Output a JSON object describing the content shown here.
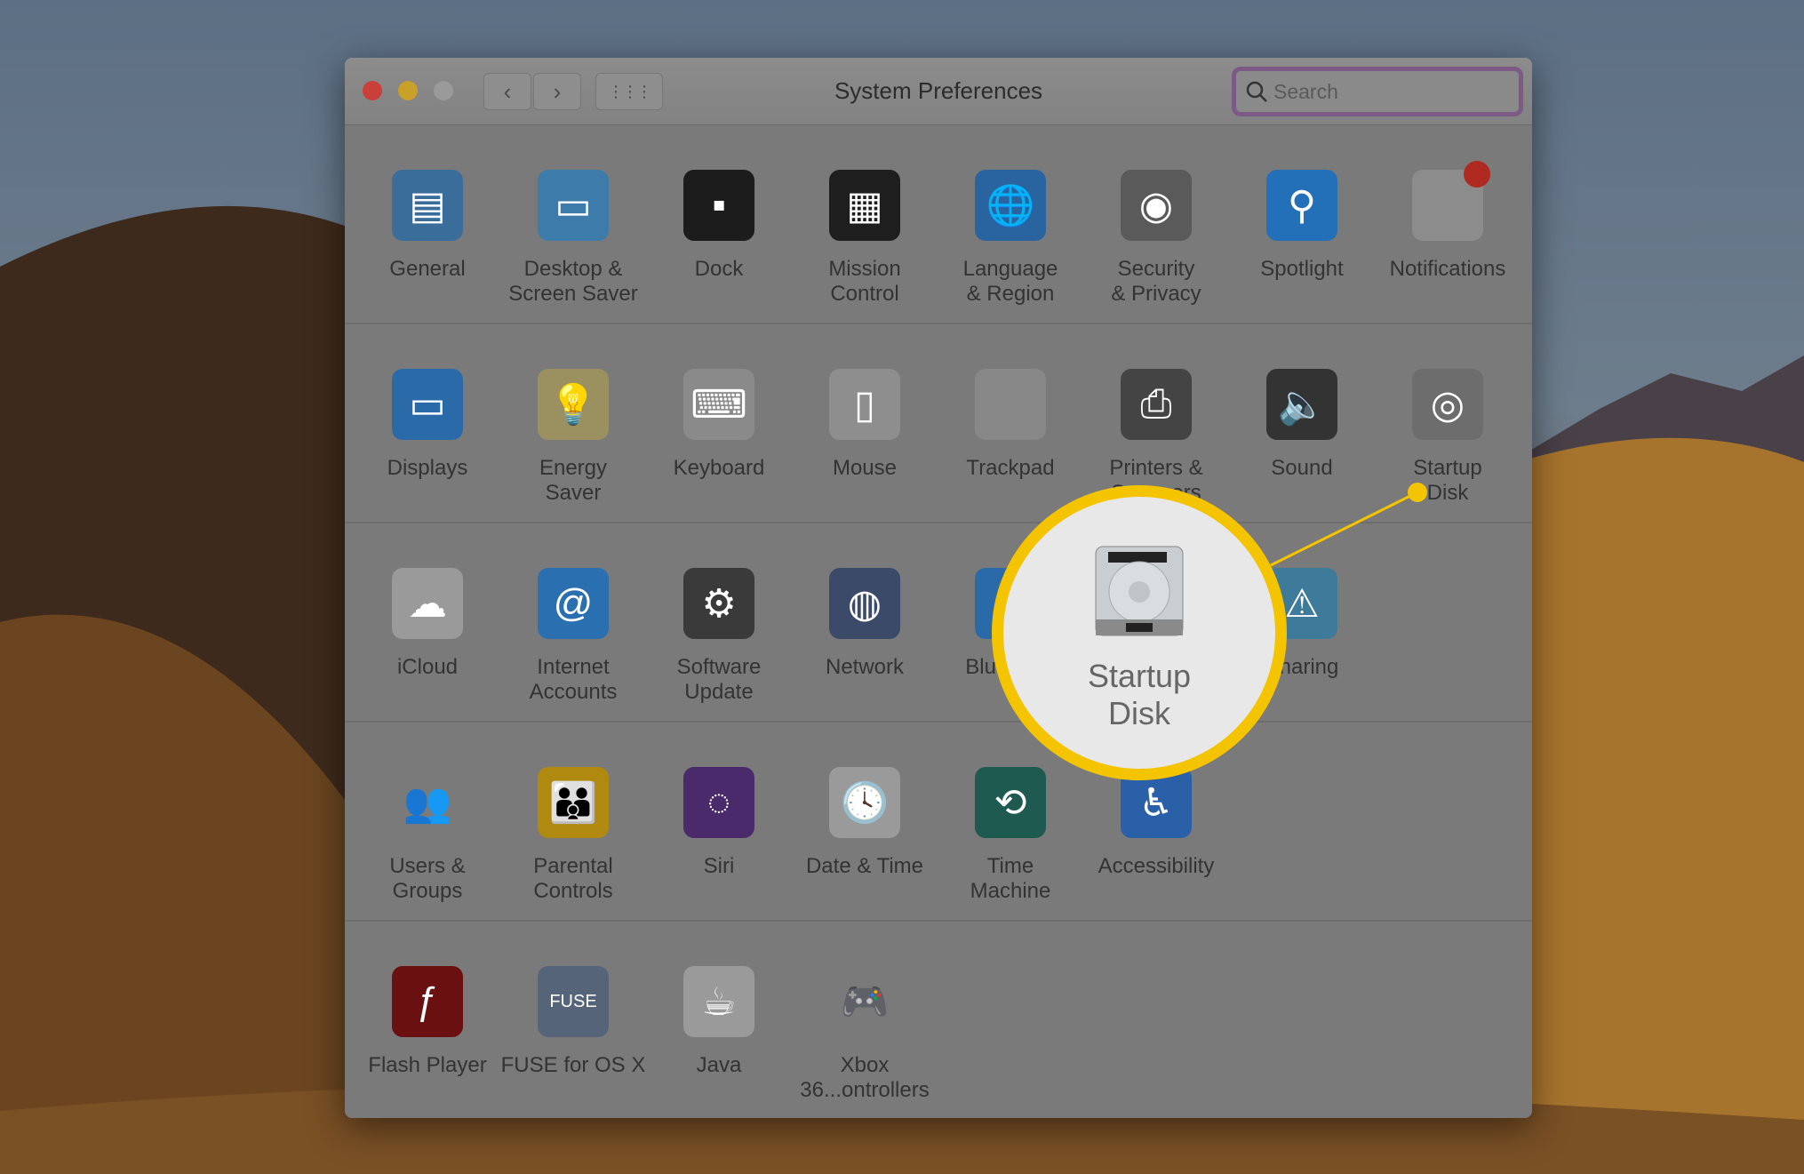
{
  "window": {
    "title": "System Preferences",
    "search_placeholder": "Search"
  },
  "titlebar": {
    "back": "‹",
    "forward": "›",
    "grid": "⋮⋮⋮"
  },
  "colors": {
    "close": "#c9403a",
    "minimize": "#c9a028",
    "zoom": "#9a9a9a",
    "highlight": "#f4c400",
    "search_focus": "#7d5a86"
  },
  "rows": [
    [
      {
        "label": "General",
        "icon": "general-icon",
        "color": "#3a6d9a",
        "glyph": "▤"
      },
      {
        "label": "Desktop &\nScreen Saver",
        "icon": "desktop-icon",
        "color": "#3d7bab",
        "glyph": "▭"
      },
      {
        "label": "Dock",
        "icon": "dock-icon",
        "color": "#1c1c1c",
        "glyph": "▪"
      },
      {
        "label": "Mission\nControl",
        "icon": "mission-control-icon",
        "color": "#1e1e1e",
        "glyph": "▦"
      },
      {
        "label": "Language\n& Region",
        "icon": "flag-globe-icon",
        "color": "#2a64a0",
        "glyph": "🌐"
      },
      {
        "label": "Security\n& Privacy",
        "icon": "security-house-icon",
        "color": "#5a5a5a",
        "glyph": "◉"
      },
      {
        "label": "Spotlight",
        "icon": "spotlight-magnifier-icon",
        "color": "#2370b8",
        "glyph": "⚲"
      },
      {
        "label": "Notifications",
        "icon": "notifications-icon",
        "color": "#8c8c8c",
        "glyph": ""
      }
    ],
    [
      {
        "label": "Displays",
        "icon": "display-icon",
        "color": "#2a6aa8",
        "glyph": "▭"
      },
      {
        "label": "Energy\nSaver",
        "icon": "lightbulb-icon",
        "color": "#9a9060",
        "glyph": "💡"
      },
      {
        "label": "Keyboard",
        "icon": "keyboard-icon",
        "color": "#8a8a8a",
        "glyph": "⌨"
      },
      {
        "label": "Mouse",
        "icon": "mouse-icon",
        "color": "#8e8e8e",
        "glyph": "▯"
      },
      {
        "label": "Trackpad",
        "icon": "trackpad-icon",
        "color": "#888",
        "glyph": ""
      },
      {
        "label": "Printers &\nScanners",
        "icon": "printer-icon",
        "color": "#444",
        "glyph": "⎙"
      },
      {
        "label": "Sound",
        "icon": "speaker-icon",
        "color": "#333",
        "glyph": "🔈"
      },
      {
        "label": "Startup\nDisk",
        "icon": "hard-disk-icon",
        "color": "#6d6d6d",
        "glyph": "◎"
      }
    ],
    [
      {
        "label": "iCloud",
        "icon": "icloud-icon",
        "color": "#9a9a9a",
        "glyph": "☁"
      },
      {
        "label": "Internet\nAccounts",
        "icon": "at-sign-icon",
        "color": "#2a70b0",
        "glyph": "@"
      },
      {
        "label": "Software\nUpdate",
        "icon": "gear-icon",
        "color": "#3a3a3a",
        "glyph": "⚙"
      },
      {
        "label": "Network",
        "icon": "globe-icon",
        "color": "#3c4a6a",
        "glyph": "◍"
      },
      {
        "label": "Bluetooth",
        "icon": "bluetooth-icon",
        "color": "#2a6aa8",
        "glyph": "ᛒ"
      },
      null,
      {
        "label": "Sharing",
        "icon": "sharing-folder-icon",
        "color": "#3e7a9a",
        "glyph": "⚠"
      }
    ],
    [
      {
        "label": "Users &\nGroups",
        "icon": "users-icon",
        "color": "transparent",
        "glyph": "👥"
      },
      {
        "label": "Parental\nControls",
        "icon": "parental-controls-icon",
        "color": "#b08a10",
        "glyph": "👪"
      },
      {
        "label": "Siri",
        "icon": "siri-icon",
        "color": "#4a2a6a",
        "glyph": "◌"
      },
      {
        "label": "Date & Time",
        "icon": "clock-calendar-icon",
        "color": "#9a9a9a",
        "glyph": "🕓"
      },
      {
        "label": "Time\nMachine",
        "icon": "time-machine-icon",
        "color": "#1e5a50",
        "glyph": "⟲"
      },
      {
        "label": "Accessibility",
        "icon": "accessibility-icon",
        "color": "#2a60a8",
        "glyph": "♿"
      }
    ],
    [
      {
        "label": "Flash Player",
        "icon": "flash-icon",
        "color": "#6a1010",
        "glyph": "ƒ"
      },
      {
        "label": "FUSE for OS X",
        "icon": "fuse-disk-icon",
        "color": "#56647a",
        "glyph": "FUSE"
      },
      {
        "label": "Java",
        "icon": "java-icon",
        "color": "#9a9a9a",
        "glyph": "☕"
      },
      {
        "label": "Xbox 36...ontrollers",
        "icon": "gamepad-icon",
        "color": "transparent",
        "glyph": "🎮"
      }
    ]
  ],
  "magnifier": {
    "label": "Startup\nDisk",
    "icon": "hard-disk-icon"
  }
}
